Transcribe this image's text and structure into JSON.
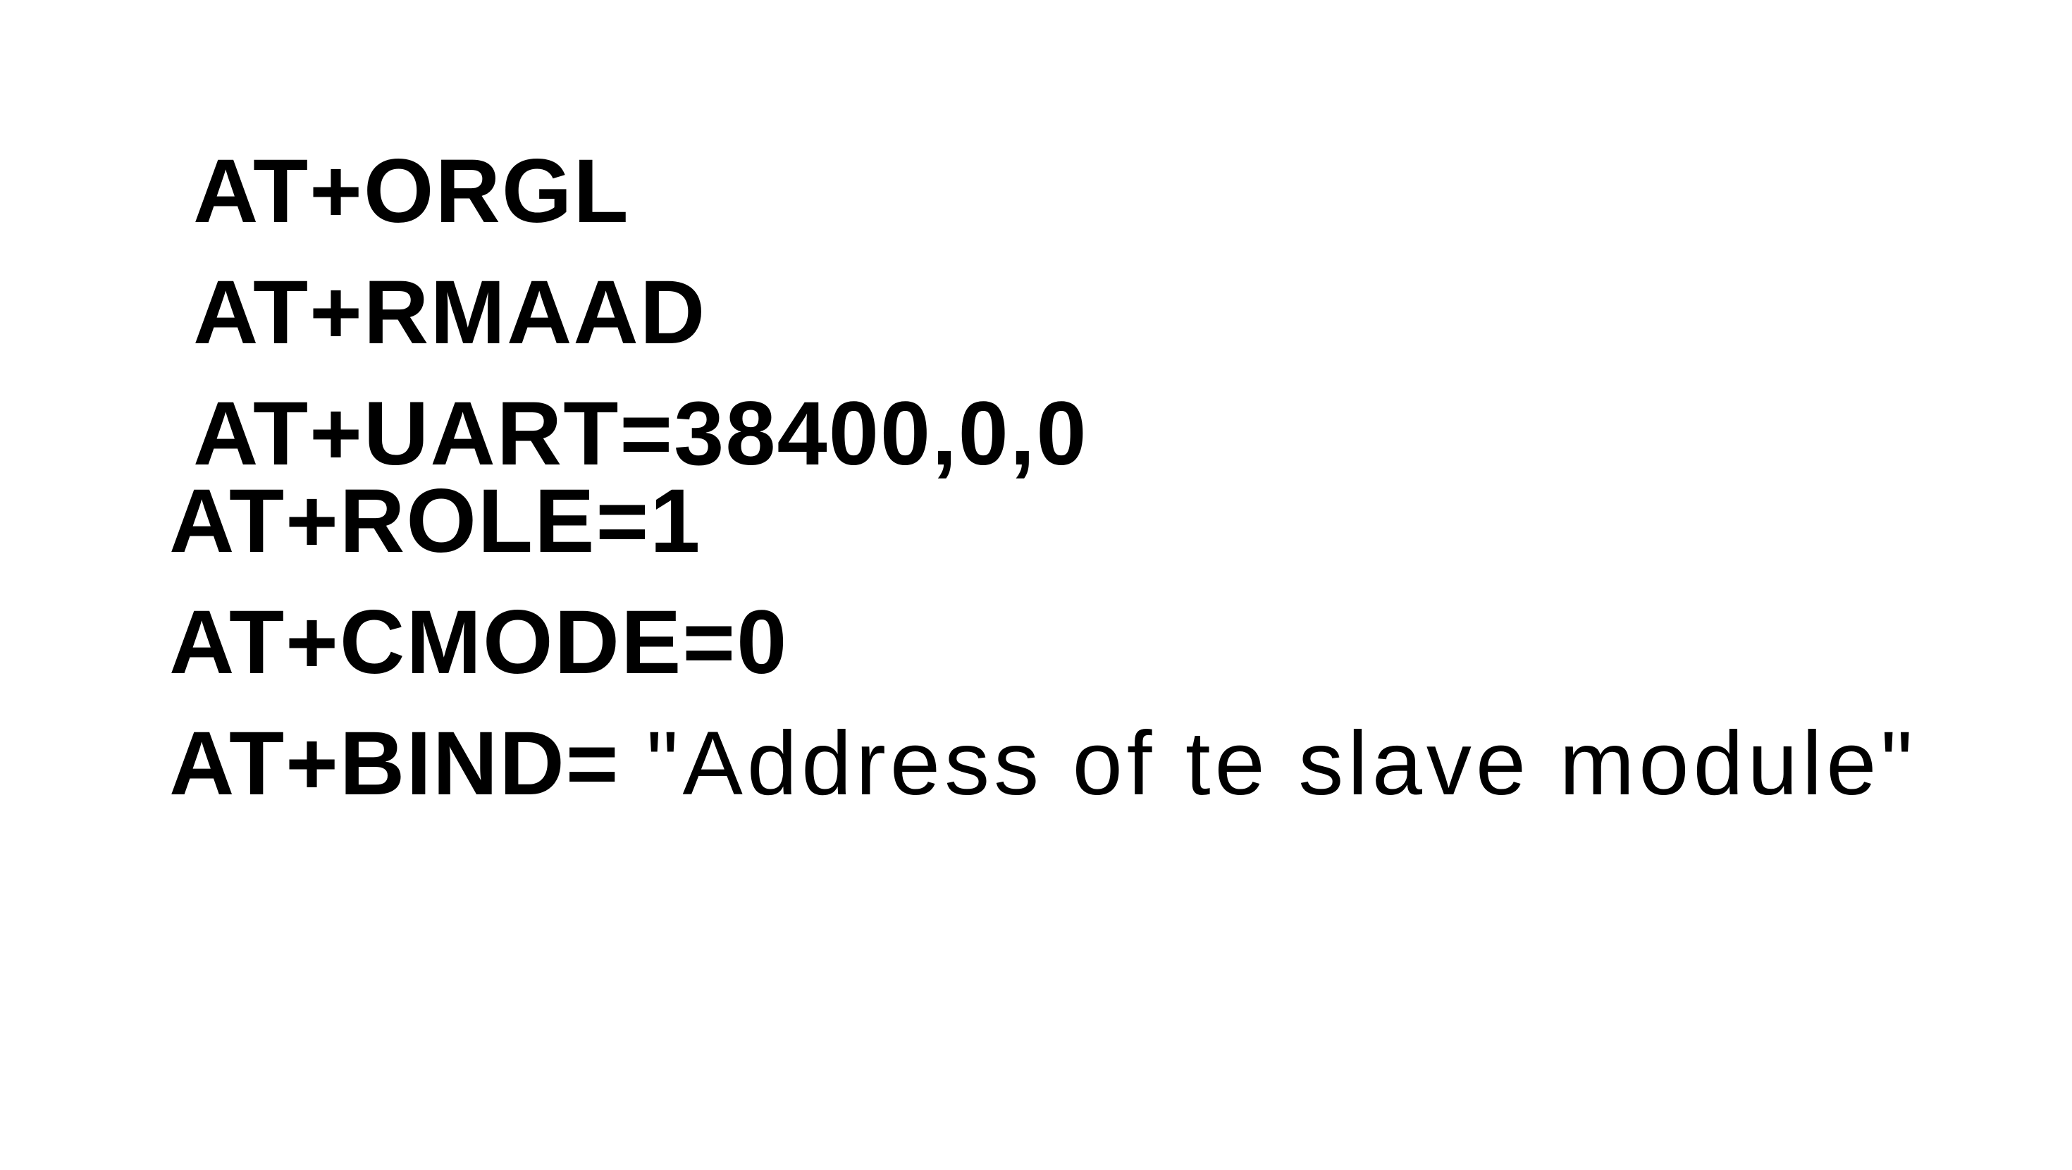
{
  "commands": [
    {
      "text": "AT+ORGL"
    },
    {
      "text": "AT+RMAAD"
    },
    {
      "text": "AT+UART=38400,0,0"
    },
    {
      "text": "AT+ROLE=1"
    },
    {
      "text": "AT+CMODE=0"
    },
    {
      "text": "AT+BIND= ",
      "argument": "\"Address of te slave module\""
    }
  ],
  "colors": {
    "background": "#ffffff",
    "text": "#000000"
  }
}
